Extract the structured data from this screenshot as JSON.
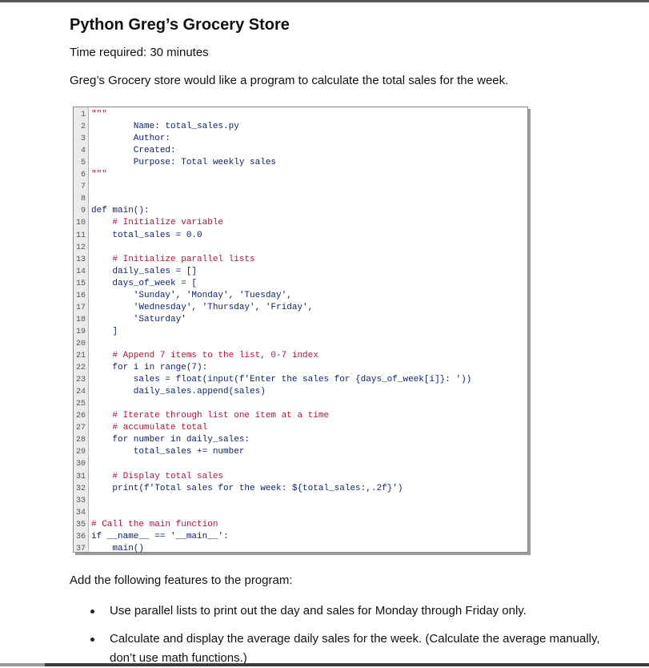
{
  "title": "Python Greg’s Grocery Store",
  "time_required": "Time required: 30 minutes",
  "intro": "Greg’s Grocery store would like a program to calculate the total sales for the week.",
  "code": {
    "lines": [
      {
        "n": "1",
        "text": "\"\"\"",
        "type": "comment"
      },
      {
        "n": "2",
        "text": "        Name: total_sales.py",
        "type": "code"
      },
      {
        "n": "3",
        "text": "        Author:",
        "type": "code"
      },
      {
        "n": "4",
        "text": "        Created:",
        "type": "code"
      },
      {
        "n": "5",
        "text": "        Purpose: Total weekly sales",
        "type": "code"
      },
      {
        "n": "6",
        "text": "\"\"\"",
        "type": "comment"
      },
      {
        "n": "7",
        "text": "",
        "type": "code"
      },
      {
        "n": "8",
        "text": "",
        "type": "code"
      },
      {
        "n": "9",
        "text": "def main():",
        "type": "code"
      },
      {
        "n": "10",
        "text": "    # Initialize variable",
        "type": "comment"
      },
      {
        "n": "11",
        "text": "    total_sales = 0.0",
        "type": "code"
      },
      {
        "n": "12",
        "text": "",
        "type": "code"
      },
      {
        "n": "13",
        "text": "    # Initialize parallel lists",
        "type": "comment"
      },
      {
        "n": "14",
        "text": "    daily_sales = []",
        "type": "code"
      },
      {
        "n": "15",
        "text": "    days_of_week = [",
        "type": "code"
      },
      {
        "n": "16",
        "text": "        'Sunday', 'Monday', 'Tuesday',",
        "type": "code"
      },
      {
        "n": "17",
        "text": "        'Wednesday', 'Thursday', 'Friday',",
        "type": "code"
      },
      {
        "n": "18",
        "text": "        'Saturday'",
        "type": "code"
      },
      {
        "n": "19",
        "text": "    ]",
        "type": "code"
      },
      {
        "n": "20",
        "text": "",
        "type": "code"
      },
      {
        "n": "21",
        "text": "    # Append 7 items to the list, 0-7 index",
        "type": "comment"
      },
      {
        "n": "22",
        "text": "    for i in range(7):",
        "type": "code"
      },
      {
        "n": "23",
        "text": "        sales = float(input(f'Enter the sales for {days_of_week[i]}: '))",
        "type": "code"
      },
      {
        "n": "24",
        "text": "        daily_sales.append(sales)",
        "type": "code"
      },
      {
        "n": "25",
        "text": "",
        "type": "code"
      },
      {
        "n": "26",
        "text": "    # Iterate through list one item at a time",
        "type": "comment"
      },
      {
        "n": "27",
        "text": "    # accumulate total",
        "type": "comment"
      },
      {
        "n": "28",
        "text": "    for number in daily_sales:",
        "type": "code"
      },
      {
        "n": "29",
        "text": "        total_sales += number",
        "type": "code"
      },
      {
        "n": "30",
        "text": "",
        "type": "code"
      },
      {
        "n": "31",
        "text": "    # Display total sales",
        "type": "comment"
      },
      {
        "n": "32",
        "text": "    print(f'Total sales for the week: ${total_sales:,.2f}')",
        "type": "code"
      },
      {
        "n": "33",
        "text": "",
        "type": "code"
      },
      {
        "n": "34",
        "text": "",
        "type": "code"
      },
      {
        "n": "35",
        "text": "# Call the main function",
        "type": "comment"
      },
      {
        "n": "36",
        "text": "if __name__ == '__main__':",
        "type": "code"
      },
      {
        "n": "37",
        "text": "    main()",
        "type": "code"
      }
    ]
  },
  "features_intro": "Add the following features to the program:",
  "bullets": [
    "Use parallel lists to print out the day and sales for Monday through Friday only.",
    "Calculate and display the average daily sales for the week. (Calculate the average manually, don’t use math functions.)"
  ]
}
